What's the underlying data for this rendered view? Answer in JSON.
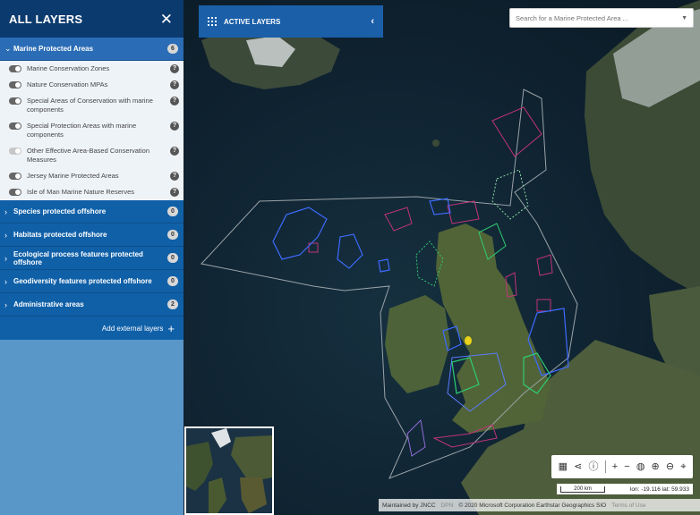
{
  "sidebar": {
    "title": "ALL LAYERS",
    "groups": [
      {
        "label": "Marine Protected Areas",
        "count": "6",
        "expanded": true
      },
      {
        "label": "Species protected offshore",
        "count": "0"
      },
      {
        "label": "Habitats protected offshore",
        "count": "0"
      },
      {
        "label": "Ecological process features protected offshore",
        "count": "0"
      },
      {
        "label": "Geodiversity features protected offshore",
        "count": "0"
      },
      {
        "label": "Administrative areas",
        "count": "2"
      }
    ],
    "mpa_items": [
      {
        "label": "Marine Conservation Zones",
        "on": true
      },
      {
        "label": "Nature Conservation MPAs",
        "on": true
      },
      {
        "label": "Special Areas of Conservation with marine components",
        "on": true
      },
      {
        "label": "Special Protection Areas with marine components",
        "on": true
      },
      {
        "label": "Other Effective Area-Based Conservation Measures",
        "on": false
      },
      {
        "label": "Jersey Marine Protected Areas",
        "on": true
      },
      {
        "label": "Isle of Man Marine Nature Reserves",
        "on": true
      }
    ],
    "add_external": "Add external layers"
  },
  "active_layers": {
    "label": "ACTIVE LAYERS"
  },
  "search": {
    "placeholder": "Search for a Marine Protected Area ..."
  },
  "scale": {
    "label": "200 km"
  },
  "coords": {
    "text": "lon: -19.116 lat: 59.933"
  },
  "attribution": {
    "maintained": "Maintained by JNCC",
    "logo": "DPN",
    "copyright": "© 2020 Microsoft Corporation Earthstar Geographics SIO",
    "terms": "Terms of Use"
  },
  "colors": {
    "header": "#0b3a6e",
    "group": "#1060a8",
    "mcz": "#c0337a",
    "sac": "#3d6bff",
    "spa": "#2ecc71"
  }
}
